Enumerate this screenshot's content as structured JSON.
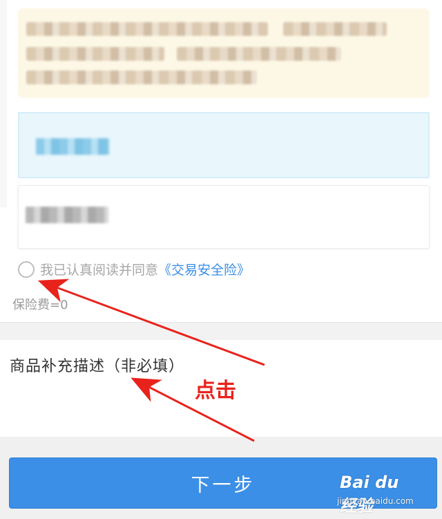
{
  "agreement": {
    "prefix": "我已认真阅读并同意",
    "link": "《交易安全险》"
  },
  "fee_label": "保险费=0",
  "description": {
    "label": "商品补充描述（非必填）"
  },
  "next_button": "下一步",
  "annotation": "点击",
  "watermark": {
    "brand": "Bai du 经验",
    "url": "jingyan.baidu.com"
  },
  "colors": {
    "accent_blue": "#3b8fe7",
    "annotation_red": "#e8231c",
    "notice_bg": "#fdf8e6"
  }
}
